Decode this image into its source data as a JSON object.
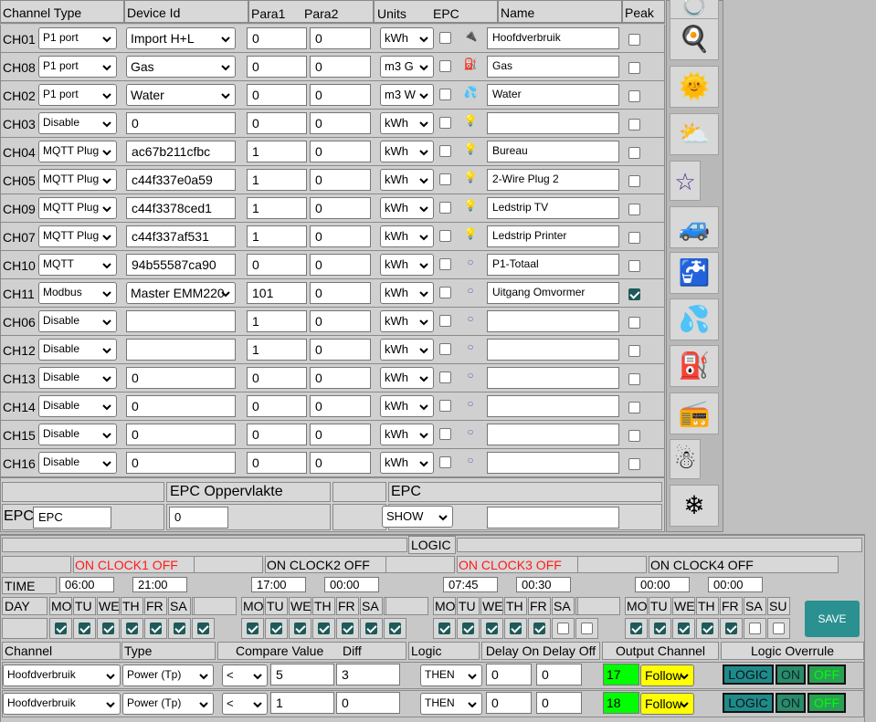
{
  "table": {
    "headers": {
      "channel_type": "Channel Type",
      "device_id": "Device Id",
      "para1": "Para1",
      "para2": "Para2",
      "units": "Units",
      "epc": "EPC",
      "name": "Name",
      "peak": "Peak"
    },
    "rows": [
      {
        "ch": "CH01",
        "type": "P1 port",
        "dev": "Import H+L",
        "dev_select": true,
        "p1": "0",
        "p2": "0",
        "unit": "kWh",
        "icon": "plug-icon",
        "glyph": "🔌",
        "name": "Hoofdverbruik",
        "peak": false
      },
      {
        "ch": "CH08",
        "type": "P1 port",
        "dev": "Gas",
        "dev_select": true,
        "p1": "0",
        "p2": "0",
        "unit": "m3 G",
        "icon": "fuel-icon",
        "glyph": "⛽",
        "name": "Gas",
        "peak": false
      },
      {
        "ch": "CH02",
        "type": "P1 port",
        "dev": "Water",
        "dev_select": true,
        "p1": "0",
        "p2": "0",
        "unit": "m3 W",
        "icon": "water-drops-icon",
        "glyph": "💦",
        "name": "Water",
        "peak": false
      },
      {
        "ch": "CH03",
        "type": "Disable",
        "dev": "0",
        "dev_select": false,
        "p1": "0",
        "p2": "0",
        "unit": "kWh",
        "icon": "bulb-icon",
        "glyph": "💡",
        "name": "",
        "peak": false
      },
      {
        "ch": "CH04",
        "type": "MQTT Plug",
        "dev": "ac67b211cfbc",
        "dev_select": false,
        "p1": "1",
        "p2": "0",
        "unit": "kWh",
        "icon": "bulb-icon",
        "glyph": "💡",
        "name": "Bureau",
        "peak": false
      },
      {
        "ch": "CH05",
        "type": "MQTT Plug",
        "dev": "c44f337e0a59",
        "dev_select": false,
        "p1": "1",
        "p2": "0",
        "unit": "kWh",
        "icon": "bulb-icon",
        "glyph": "💡",
        "name": "2-Wire Plug 2",
        "peak": false
      },
      {
        "ch": "CH09",
        "type": "MQTT Plug",
        "dev": "c44f3378ced1",
        "dev_select": false,
        "p1": "1",
        "p2": "0",
        "unit": "kWh",
        "icon": "bulb-icon",
        "glyph": "💡",
        "name": "Ledstrip TV",
        "peak": false
      },
      {
        "ch": "CH07",
        "type": "MQTT Plug",
        "dev": "c44f337af531",
        "dev_select": false,
        "p1": "1",
        "p2": "0",
        "unit": "kWh",
        "icon": "bulb-icon",
        "glyph": "💡",
        "name": "Ledstrip Printer",
        "peak": false
      },
      {
        "ch": "CH10",
        "type": "MQTT",
        "dev": "94b55587ca90",
        "dev_select": false,
        "p1": "0",
        "p2": "0",
        "unit": "kWh",
        "icon": "circle-icon",
        "glyph": "○",
        "name": "P1-Totaal",
        "peak": false
      },
      {
        "ch": "CH11",
        "type": "Modbus",
        "dev": "Master EMM220",
        "dev_select": true,
        "p1": "101",
        "p2": "0",
        "unit": "kWh",
        "icon": "circle-icon",
        "glyph": "○",
        "name": "Uitgang Omvormer",
        "peak": true
      },
      {
        "ch": "CH06",
        "type": "Disable",
        "dev": "",
        "dev_select": false,
        "p1": "1",
        "p2": "0",
        "unit": "kWh",
        "icon": "circle-icon",
        "glyph": "○",
        "name": "",
        "peak": false
      },
      {
        "ch": "CH12",
        "type": "Disable",
        "dev": "",
        "dev_select": false,
        "p1": "1",
        "p2": "0",
        "unit": "kWh",
        "icon": "circle-icon",
        "glyph": "○",
        "name": "",
        "peak": false
      },
      {
        "ch": "CH13",
        "type": "Disable",
        "dev": "0",
        "dev_select": false,
        "p1": "0",
        "p2": "0",
        "unit": "kWh",
        "icon": "circle-icon",
        "glyph": "○",
        "name": "",
        "peak": false
      },
      {
        "ch": "CH14",
        "type": "Disable",
        "dev": "0",
        "dev_select": false,
        "p1": "0",
        "p2": "0",
        "unit": "kWh",
        "icon": "circle-icon",
        "glyph": "○",
        "name": "",
        "peak": false
      },
      {
        "ch": "CH15",
        "type": "Disable",
        "dev": "0",
        "dev_select": false,
        "p1": "0",
        "p2": "0",
        "unit": "kWh",
        "icon": "circle-icon",
        "glyph": "○",
        "name": "",
        "peak": false
      },
      {
        "ch": "CH16",
        "type": "Disable",
        "dev": "0",
        "dev_select": false,
        "p1": "0",
        "p2": "0",
        "unit": "kWh",
        "icon": "circle-icon",
        "glyph": "○",
        "name": "",
        "peak": false
      }
    ]
  },
  "epc": {
    "opp_header": "EPC Oppervlakte",
    "epc_header": "EPC",
    "label": "EPC",
    "input": "EPC",
    "opp_value": "0",
    "show": "SHOW",
    "name": ""
  },
  "logic": {
    "title": "LOGIC",
    "time_label": "TIME",
    "day_label": "DAY",
    "clocks": [
      {
        "label": "ON CLOCK1 OFF",
        "active": true,
        "on": "06:00",
        "off": "21:00",
        "days": [
          true,
          true,
          true,
          true,
          true,
          true,
          true
        ]
      },
      {
        "label": "ON CLOCK2 OFF",
        "active": false,
        "on": "17:00",
        "off": "00:00",
        "days": [
          true,
          true,
          true,
          true,
          true,
          true,
          true
        ]
      },
      {
        "label": "ON CLOCK3 OFF",
        "active": true,
        "on": "07:45",
        "off": "00:30",
        "days": [
          true,
          true,
          true,
          true,
          true,
          false,
          false
        ]
      },
      {
        "label": "ON CLOCK4 OFF",
        "active": false,
        "on": "00:00",
        "off": "00:00",
        "days": [
          true,
          true,
          true,
          true,
          true,
          false,
          false
        ]
      }
    ],
    "days": [
      "MO",
      "TU",
      "WE",
      "TH",
      "FR",
      "SA",
      "SU"
    ],
    "save": "SAVE",
    "headers": {
      "channel": "Channel",
      "type": "Type",
      "compare": "Compare Value",
      "diff": "Diff",
      "logic": "Logic",
      "delay": "Delay On Delay Off",
      "output": "Output Channel",
      "overrule": "Logic Overrule"
    },
    "rules": [
      {
        "channel": "Hoofdverbruik",
        "type": "Power (Tp)",
        "op": "<",
        "value": "5",
        "diff": "3",
        "logic": "THEN",
        "don": "0",
        "doff": "0",
        "out": "17",
        "mode": "Follow"
      },
      {
        "channel": "Hoofdverbruik",
        "type": "Power (Tp)",
        "op": "<",
        "value": "1",
        "diff": "0",
        "logic": "THEN",
        "don": "0",
        "doff": "0",
        "out": "18",
        "mode": "Follow"
      }
    ],
    "overrule_buttons": [
      "LOGIC",
      "ON",
      "OFF"
    ]
  },
  "sidebar": [
    {
      "icon": "ring-icon",
      "glyph": "💍"
    },
    {
      "icon": "cooking-pan-icon",
      "glyph": "🍳"
    },
    {
      "icon": "sun-face-icon",
      "glyph": "🌞"
    },
    {
      "icon": "sun-cloud-icon",
      "glyph": "⛅"
    },
    {
      "icon": "star-icon",
      "glyph": "☆"
    },
    {
      "icon": "car-icon",
      "glyph": "🚙"
    },
    {
      "icon": "sink-icon",
      "glyph": "🚰"
    },
    {
      "icon": "water-drops-icon",
      "glyph": "💦"
    },
    {
      "icon": "fuel-pump-icon",
      "glyph": "⛽"
    },
    {
      "icon": "radio-icon",
      "glyph": "📻"
    },
    {
      "icon": "snowman-icon",
      "glyph": "☃"
    },
    {
      "icon": "snowflake-icon",
      "glyph": "❄"
    }
  ],
  "colors": {
    "red_label": "#ff1a1a",
    "green": "#00ff00",
    "yellow": "#ffff00",
    "teal": "#1e8a8a",
    "btn_teal": "#2a9090"
  }
}
